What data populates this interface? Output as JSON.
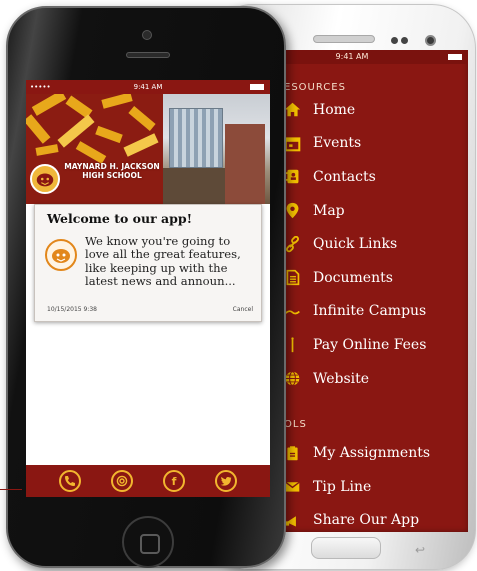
{
  "back_phone": {
    "status_time": "9:41 AM",
    "sections": [
      {
        "label": "ESOURCES"
      },
      {
        "label": "OLS"
      }
    ],
    "resources": [
      {
        "label": "Home",
        "icon": "home-icon"
      },
      {
        "label": "Events",
        "icon": "calendar-icon"
      },
      {
        "label": "Contacts",
        "icon": "contacts-book-icon"
      },
      {
        "label": "Map",
        "icon": "map-pin-icon"
      },
      {
        "label": "Quick Links",
        "icon": "link-icon"
      },
      {
        "label": "Documents",
        "icon": "document-icon"
      },
      {
        "label": "Infinite Campus",
        "icon": "infinity-icon"
      },
      {
        "label": "Pay Online Fees",
        "icon": "dollar-icon"
      },
      {
        "label": "Website",
        "icon": "globe-icon"
      }
    ],
    "tools": [
      {
        "label": "My Assignments",
        "icon": "clipboard-icon"
      },
      {
        "label": "Tip Line",
        "icon": "envelope-icon"
      },
      {
        "label": "Share Our App",
        "icon": "megaphone-icon"
      }
    ]
  },
  "front_phone": {
    "status_carrier": "••••• ",
    "status_time": "9:41 AM",
    "school": {
      "name_line1": "MAYNARD H. JACKSON",
      "name_line2": "HIGH SCHOOL"
    },
    "notification": {
      "title": "Welcome to our app!",
      "body_lines": [
        "We know you're going to",
        "love all the great features,",
        "like keeping up with the",
        "latest news and announ..."
      ],
      "date": "10/15/2015 9:38",
      "cancel": "Cancel"
    },
    "bottom_nav": [
      {
        "icon": "phone-icon"
      },
      {
        "icon": "at-sign-icon"
      },
      {
        "icon": "facebook-icon",
        "glyph": "f"
      },
      {
        "icon": "twitter-icon"
      }
    ]
  },
  "colors": {
    "brand_red": "#8a1712",
    "brand_gold": "#f2b62f"
  }
}
